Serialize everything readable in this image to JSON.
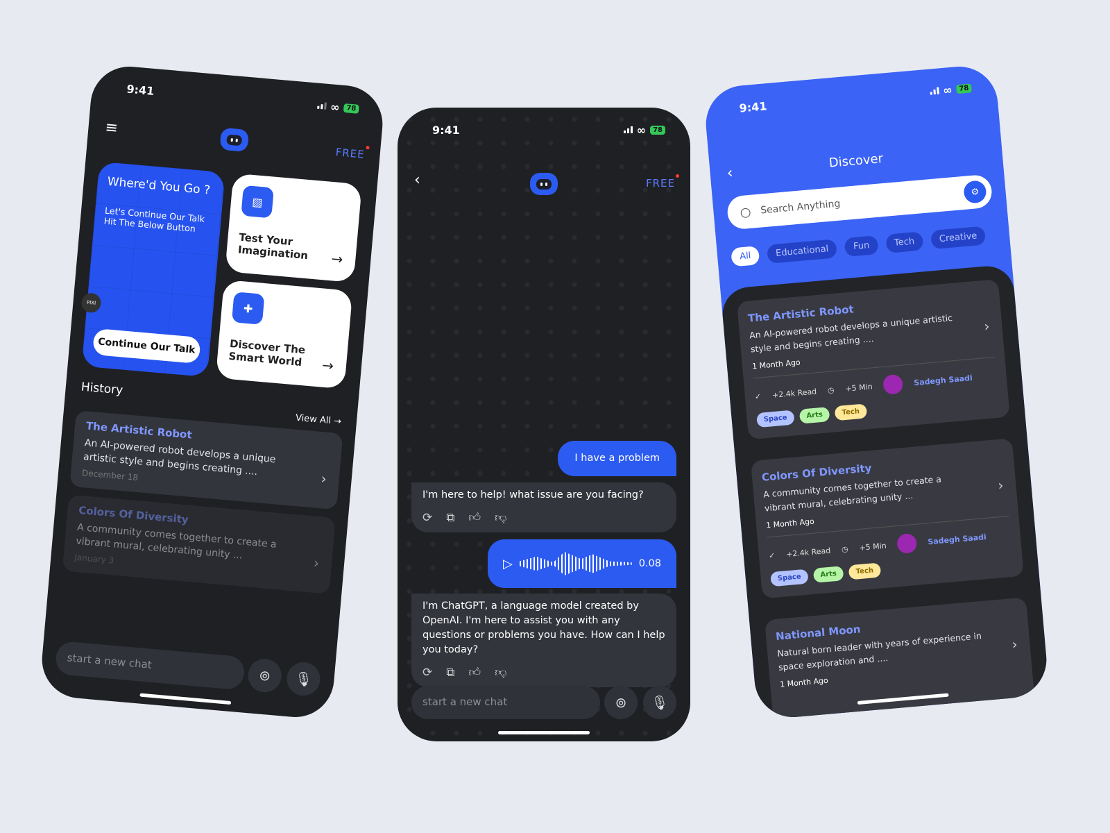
{
  "status": {
    "time": "9:41",
    "battery": "78"
  },
  "home": {
    "badge": "FREE",
    "hero": {
      "title": "Where'd You Go ?",
      "line1": "Let's Continue Our Talk",
      "line2": "Hit The Below Button",
      "button": "Continue Our Talk",
      "sticker": "PIXI"
    },
    "cards": [
      {
        "label1": "Test Your",
        "label2": "Imagination",
        "icon": "image-icon"
      },
      {
        "label1": "Discover The",
        "label2": "Smart World",
        "icon": "globe-icon"
      }
    ],
    "history_label": "History",
    "view_all": "View All",
    "history": [
      {
        "title": "The Artistic Robot",
        "text": "An AI-powered robot develops a unique artistic style and begins creating ....",
        "date": "December 18"
      },
      {
        "title": "Colors Of Diversity",
        "text": "A community comes together to create a vibrant mural, celebrating unity ...",
        "date": "January 3"
      }
    ],
    "input_placeholder": "start a new chat"
  },
  "chat": {
    "badge": "FREE",
    "messages": [
      {
        "role": "user",
        "text": "I have a problem"
      },
      {
        "role": "assistant",
        "text": "I'm here to help! what issue are you facing?"
      },
      {
        "role": "user-audio",
        "duration": "0.08"
      },
      {
        "role": "assistant",
        "text": "I'm ChatGPT, a language model created by OpenAI. I'm here to assist you with any questions or problems you have. How can I help you today?"
      }
    ],
    "input_placeholder": "start a new chat"
  },
  "discover": {
    "title": "Discover",
    "search_placeholder": "Search Anything",
    "chips": [
      "All",
      "Educational",
      "Fun",
      "Tech",
      "Creative"
    ],
    "active_chip": "All",
    "cards": [
      {
        "title": "The Artistic Robot",
        "text": "An AI-powered robot develops a unique artistic style and begins creating ....",
        "date": "1 Month Ago",
        "reads": "+2.4k Read",
        "time": "+5 Min",
        "author": "Sadegh Saadi",
        "tags": [
          "Space",
          "Arts",
          "Tech"
        ]
      },
      {
        "title": "Colors Of Diversity",
        "text": "A community comes together to create a vibrant mural, celebrating unity ...",
        "date": "1 Month Ago",
        "reads": "+2.4k Read",
        "time": "+5 Min",
        "author": "Sadegh Saadi",
        "tags": [
          "Space",
          "Arts",
          "Tech"
        ]
      },
      {
        "title": "National Moon",
        "text": "Natural born leader with years of experience in space exploration and ....",
        "date": "1 Month Ago"
      }
    ]
  },
  "colors": {
    "accent": "#2c5bf2",
    "background": "#1f2024",
    "tag_space": "#b3c3ff",
    "tag_arts": "#b6f5a8",
    "tag_tech": "#ffe89a"
  }
}
